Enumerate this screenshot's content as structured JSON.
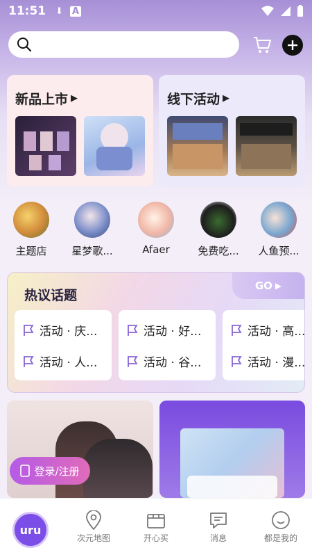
{
  "status": {
    "time": "11:51"
  },
  "search": {
    "placeholder": ""
  },
  "promos": [
    {
      "title": "新品上市"
    },
    {
      "title": "线下活动"
    }
  ],
  "categories": [
    {
      "label": "主题店"
    },
    {
      "label": "星梦歌..."
    },
    {
      "label": "Afaer"
    },
    {
      "label": "免费吃..."
    },
    {
      "label": "人鱼预..."
    }
  ],
  "topics": {
    "title": "热议话题",
    "go": "GO",
    "cards": [
      {
        "items": [
          "活动 · 庆...",
          "活动 · 人..."
        ]
      },
      {
        "items": [
          "活动 · 好...",
          "活动 · 谷..."
        ]
      },
      {
        "items": [
          "活动 · 高...",
          "活动 · 漫..."
        ]
      }
    ]
  },
  "login_label": "登录/注册",
  "nav": [
    {
      "label": "次元地图",
      "icon": "map-pin-icon"
    },
    {
      "label": "开心买",
      "icon": "box-icon"
    },
    {
      "label": "消息",
      "icon": "message-icon"
    },
    {
      "label": "都是我的",
      "icon": "smiley-icon"
    }
  ],
  "colors": {
    "accent": "#7c4ee8",
    "login_gradient_start": "#b55be8",
    "login_gradient_end": "#e06bb8"
  }
}
